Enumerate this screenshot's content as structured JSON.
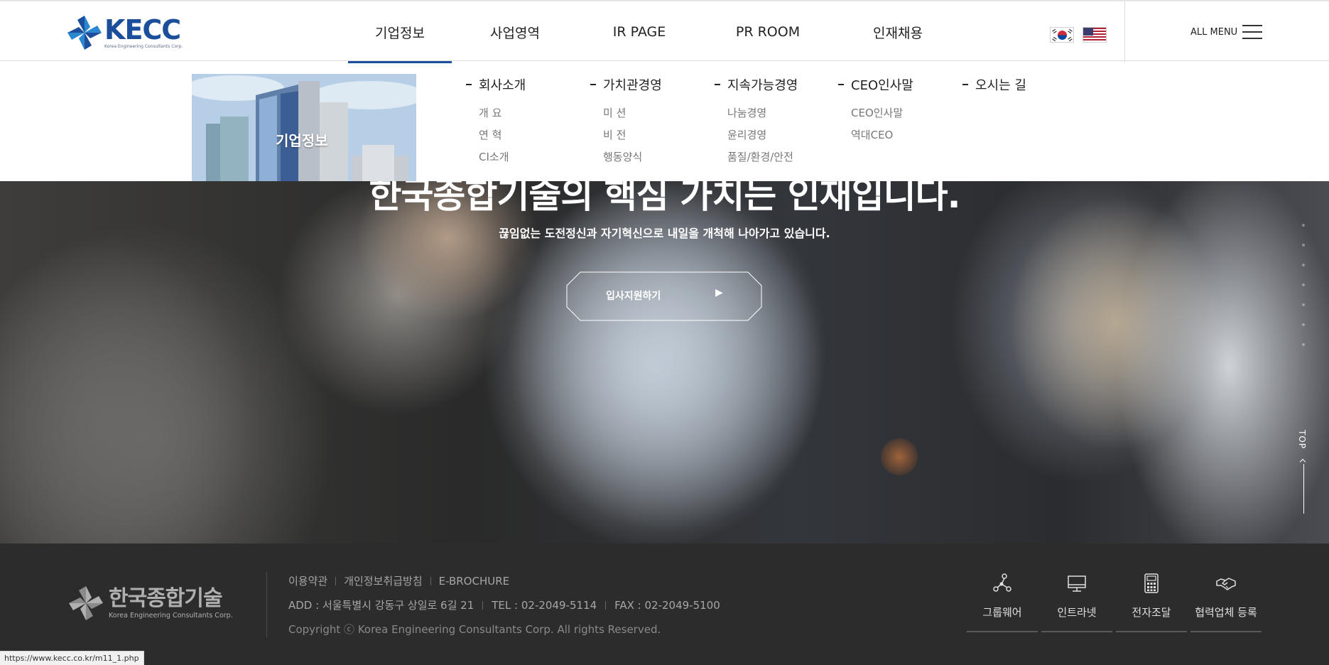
{
  "header": {
    "logo_word": "KECC",
    "logo_sub": "Korea Engineering Consultants Corp.",
    "nav": [
      {
        "label": "기업정보",
        "active": true
      },
      {
        "label": "사업영역",
        "active": false
      },
      {
        "label": "IR PAGE",
        "active": false
      },
      {
        "label": "PR ROOM",
        "active": false
      },
      {
        "label": "인재채용",
        "active": false
      }
    ],
    "languages": [
      "korean-flag-icon",
      "us-flag-icon"
    ],
    "all_menu_label": "ALL MENU"
  },
  "mega_menu": {
    "banner_title": "기업정보",
    "columns": [
      {
        "heading": "회사소개",
        "items": [
          "개 요",
          "연 혁",
          "CI소개"
        ]
      },
      {
        "heading": "가치관경영",
        "items": [
          "미 션",
          "비 전",
          "행동양식"
        ]
      },
      {
        "heading": "지속가능경영",
        "items": [
          "나눔경영",
          "윤리경영",
          "품질/환경/안전"
        ]
      },
      {
        "heading": "CEO인사말",
        "items": [
          "CEO인사말",
          "역대CEO"
        ]
      },
      {
        "heading": "오시는 길",
        "items": []
      }
    ]
  },
  "hero": {
    "title": "한국종합기술의 핵심 가치는 인재입니다.",
    "subtitle": "끊임없는 도전정신과 자기혁신으로 내일을 개척해 나아가고 있습니다.",
    "button_label": "입사지원하기",
    "button_arrow": "▶",
    "top_label": "TOP"
  },
  "footer": {
    "logo_ko": "한국종합기술",
    "logo_en": "Korea Engineering Consultants Corp.",
    "links": [
      "이용약관",
      "개인정보취급방침",
      "E-BROCHURE"
    ],
    "address": "ADD : 서울특별시 강동구 상일로 6길 21",
    "tel": "TEL : 02-2049-5114",
    "fax": "FAX : 02-2049-5100",
    "copyright": "Copyright ⓒ Korea Engineering Consultants Corp. All rights Reserved.",
    "services": [
      {
        "label": "그룹웨어",
        "icon": "network-icon"
      },
      {
        "label": "인트라넷",
        "icon": "monitor-icon"
      },
      {
        "label": "전자조달",
        "icon": "calculator-icon"
      },
      {
        "label": "협력업체 등록",
        "icon": "handshake-icon"
      }
    ]
  },
  "statusbar": {
    "url": "https://www.kecc.co.kr/m11_1.php"
  },
  "colors": {
    "brand": "#1b4f9c",
    "footer_bg": "#2c2c2c"
  }
}
